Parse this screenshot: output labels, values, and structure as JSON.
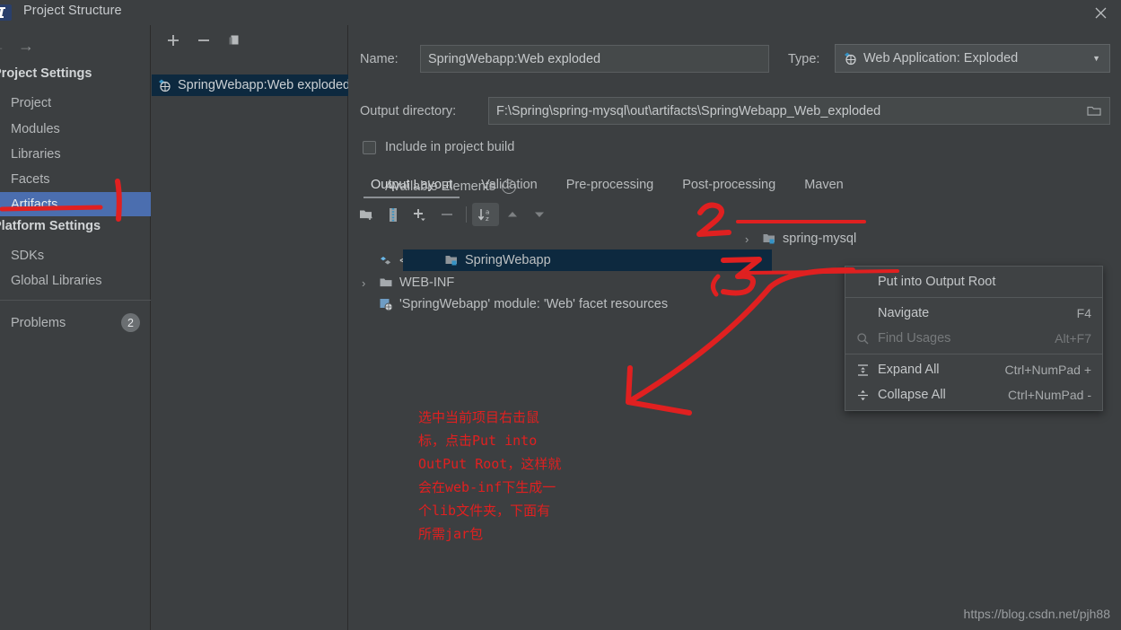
{
  "window": {
    "title": "Project Structure",
    "close_label": "✕",
    "app_icon": "intellij-idea-icon"
  },
  "sidebar": {
    "nav": {
      "back": "←",
      "forward": "→"
    },
    "groups": [
      {
        "title": "Project Settings",
        "items": [
          {
            "label": "Project",
            "selected": false
          },
          {
            "label": "Modules",
            "selected": false
          },
          {
            "label": "Libraries",
            "selected": false
          },
          {
            "label": "Facets",
            "selected": false
          },
          {
            "label": "Artifacts",
            "selected": true
          }
        ]
      },
      {
        "title": "Platform Settings",
        "items": [
          {
            "label": "SDKs",
            "selected": false
          },
          {
            "label": "Global Libraries",
            "selected": false
          }
        ]
      }
    ],
    "problems": {
      "label": "Problems",
      "count": "2"
    }
  },
  "artifacts_panel": {
    "toolbar": [
      {
        "name": "add-artifact-button",
        "glyph": "+"
      },
      {
        "name": "remove-artifact-button",
        "glyph": "−"
      },
      {
        "name": "copy-artifact-button",
        "glyph": "copy-icon"
      }
    ],
    "items": [
      {
        "label": "SpringWebapp:Web exploded",
        "selected": true,
        "icon": "web-artifact-icon"
      }
    ]
  },
  "form": {
    "name_label": "Name:",
    "name_value": "SpringWebapp:Web exploded",
    "type_label": "Type:",
    "type_value": "Web Application: Exploded",
    "output_dir_label": "Output directory:",
    "output_dir_value": "F:\\Spring\\spring-mysql\\out\\artifacts\\SpringWebapp_Web_exploded",
    "include_in_build_label": "Include in project build",
    "include_in_build_checked": false
  },
  "tabs": [
    {
      "label": "Output Layout",
      "active": true
    },
    {
      "label": "Validation",
      "active": false
    },
    {
      "label": "Pre-processing",
      "active": false
    },
    {
      "label": "Post-processing",
      "active": false
    },
    {
      "label": "Maven",
      "active": false
    }
  ],
  "layout_toolbar": [
    {
      "name": "create-directory-button",
      "icon": "folder-add-icon",
      "boxed": false
    },
    {
      "name": "create-archive-button",
      "icon": "archive-icon",
      "boxed": false
    },
    {
      "name": "add-copy-of-button",
      "icon": "plus-dropdown-icon",
      "boxed": false
    },
    {
      "name": "remove-element-button",
      "icon": "minus-icon",
      "boxed": false
    },
    {
      "name": "sort-alphabetically-button",
      "icon": "sort-az-icon",
      "boxed": true
    },
    {
      "name": "move-up-button",
      "icon": "triangle-up-icon",
      "boxed": false
    },
    {
      "name": "move-down-button",
      "icon": "triangle-down-icon",
      "boxed": false
    }
  ],
  "output_tree": [
    {
      "label": "<output root>",
      "icon": "output-root-icon",
      "indent": 0,
      "expander": ""
    },
    {
      "label": "WEB-INF",
      "icon": "folder-icon",
      "indent": 0,
      "expander": "›"
    },
    {
      "label": "'SpringWebapp' module: 'Web' facet resources",
      "icon": "web-facet-icon",
      "indent": 1,
      "expander": ""
    }
  ],
  "available_elements": {
    "title": "Available Elements",
    "help_glyph": "?",
    "items": [
      {
        "label": "spring-mysql",
        "expander": "›",
        "icon": "module-icon",
        "selected": false
      },
      {
        "label": "SpringWebapp",
        "expander": "",
        "icon": "module-icon",
        "selected": true
      }
    ]
  },
  "context_menu": [
    {
      "label": "Put into Output Root",
      "shortcut": "",
      "icon": "",
      "disabled": false
    },
    {
      "separator": true
    },
    {
      "label": "Navigate",
      "shortcut": "F4",
      "icon": "",
      "disabled": false
    },
    {
      "label": "Find Usages",
      "shortcut": "Alt+F7",
      "icon": "search-icon",
      "disabled": true
    },
    {
      "separator": true
    },
    {
      "label": "Expand All",
      "shortcut": "Ctrl+NumPad +",
      "icon": "expand-all-icon",
      "disabled": false
    },
    {
      "label": "Collapse All",
      "shortcut": "Ctrl+NumPad -",
      "icon": "collapse-all-icon",
      "disabled": false
    }
  ],
  "annotations": {
    "marker_2": "2",
    "marker_3": "3",
    "note_text": "选中当前项目右击鼠\n标，点击Put into\nOutPut Root，这样就\n会在web-inf下生成一\n个lib文件夹，下面有\n所需jar包",
    "color": "#e02020"
  },
  "watermark": "https://blog.csdn.net/pjh88"
}
